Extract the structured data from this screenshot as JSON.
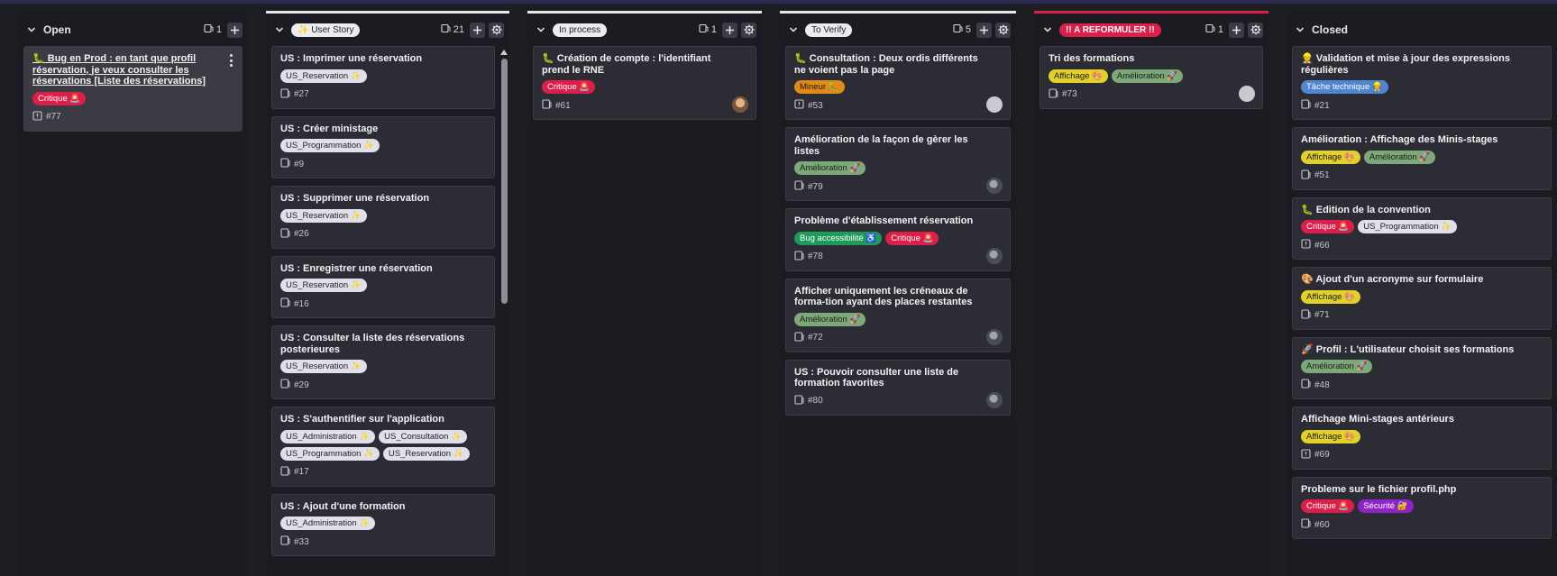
{
  "colors": {
    "critique": "#dc1f4a",
    "mineur": "#e08a1a",
    "amelioration": "#7fa87a",
    "affichage": "#e3d12a",
    "us_tag": "#dfe0ea",
    "bug_access": "#1e9b58",
    "tache": "#4f86cf",
    "securite": "#8e23c9"
  },
  "columns": [
    {
      "title": "Open",
      "count": "1",
      "cards": [
        {
          "title": "🐛 Bug en Prod : en tant que profil réservation, je veux consulter les réservations [Liste des réservations]",
          "tags": [
            "Critique 🚨"
          ],
          "id": "#77"
        }
      ]
    },
    {
      "title": "✨ User Story",
      "count": "21",
      "cards": [
        {
          "title": "US : Imprimer une réservation",
          "tags": [
            "US_Reservation ✨"
          ],
          "id": "#27"
        },
        {
          "title": "US : Créer ministage",
          "tags": [
            "US_Programmation ✨"
          ],
          "id": "#9"
        },
        {
          "title": "US : Supprimer une réservation",
          "tags": [
            "US_Reservation ✨"
          ],
          "id": "#26"
        },
        {
          "title": "US : Enregistrer une réservation",
          "tags": [
            "US_Reservation ✨"
          ],
          "id": "#16"
        },
        {
          "title": "US : Consulter la liste des réservations posterieures",
          "tags": [
            "US_Reservation ✨"
          ],
          "id": "#29"
        },
        {
          "title": "US : S'authentifier sur l'application",
          "tags": [
            "US_Administration ✨",
            "US_Consultation ✨",
            "US_Programmation ✨",
            "US_Reservation ✨"
          ],
          "id": "#17"
        },
        {
          "title": "US : Ajout d'une formation",
          "tags": [
            "US_Administration ✨"
          ],
          "id": "#33"
        }
      ]
    },
    {
      "title": "In process",
      "count": "1",
      "cards": [
        {
          "title": "🐛 Création de compte : l'identifiant prend le RNE",
          "tags": [
            "Critique 🚨"
          ],
          "id": "#61"
        }
      ]
    },
    {
      "title": "To Verify",
      "count": "5",
      "cards": [
        {
          "title": "🐛 Consultation : Deux ordis différents ne voient pas la page",
          "tags": [
            "Mineur 🐛"
          ],
          "id": "#53"
        },
        {
          "title": "Amélioration de la façon de gèrer les listes",
          "tags": [
            "Amélioration 🚀"
          ],
          "id": "#79"
        },
        {
          "title": "Problème d'établissement réservation",
          "tags": [
            "Bug accessibilité ♿",
            "Critique 🚨"
          ],
          "id": "#78"
        },
        {
          "title": "Afficher uniquement les créneaux de forma-tion ayant des places restantes",
          "tags": [
            "Amélioration 🚀"
          ],
          "id": "#72"
        },
        {
          "title": "US : Pouvoir consulter une liste de formation favorites",
          "tags": [],
          "id": "#80"
        }
      ]
    },
    {
      "title": "!! A REFORMULER !!",
      "count": "1",
      "cards": [
        {
          "title": "Tri des formations",
          "tags": [
            "Affichage 🎨",
            "Amélioration 🚀"
          ],
          "id": "#73"
        }
      ]
    },
    {
      "title": "Closed",
      "count": "",
      "cards": [
        {
          "title": "👷 Validation et mise à jour des expressions régulières",
          "tags": [
            "Tâche technique 👷"
          ],
          "id": "#21"
        },
        {
          "title": "Amélioration : Affichage des Minis-stages",
          "tags": [
            "Affichage 🎨",
            "Amélioration 🚀"
          ],
          "id": "#51"
        },
        {
          "title": "🐛 Edition de la convention",
          "tags": [
            "Critique 🚨",
            "US_Programmation ✨"
          ],
          "id": "#66"
        },
        {
          "title": "🎨 Ajout d'un acronyme sur formulaire",
          "tags": [
            "Affichage 🎨"
          ],
          "id": "#71"
        },
        {
          "title": "🚀 Profil : L'utilisateur choisit ses formations",
          "tags": [
            "Amélioration 🚀"
          ],
          "id": "#48"
        },
        {
          "title": "Affichage Mini-stages antérieurs",
          "tags": [
            "Affichage 🎨"
          ],
          "id": "#69"
        },
        {
          "title": "Probleme sur le fichier profil.php",
          "tags": [
            "Critique 🚨",
            "Sécurité 🔐"
          ],
          "id": "#60"
        }
      ]
    }
  ]
}
